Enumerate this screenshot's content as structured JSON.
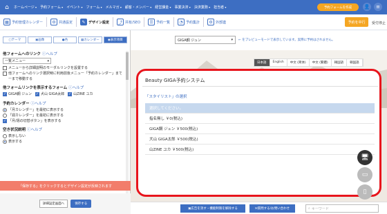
{
  "topbar": {
    "nav": [
      "ホームページ",
      "予約フォーム",
      "イベント",
      "フォーム",
      "メルマガ",
      "顧客・メンバー",
      "経営課金",
      "事業決済",
      "決済業務",
      "担当者"
    ],
    "cta_label": "予約フォームを作成",
    "accent": "#3d6ec2"
  },
  "toolbar": {
    "items": [
      {
        "label": "予約管理カレンダー",
        "icon": "calendar-icon"
      },
      {
        "label": "共通設定",
        "icon": "gear-icon"
      },
      {
        "label": "デザイン設定",
        "icon": "palette-icon"
      },
      {
        "label": "共有/SEO",
        "icon": "share-icon"
      },
      {
        "label": "予約一覧",
        "icon": "list-icon"
      },
      {
        "label": "予約集計",
        "icon": "chart-icon"
      },
      {
        "label": "外部連",
        "icon": "link-icon"
      }
    ],
    "trial_label": "予約を中行",
    "stop_label": "受付停止"
  },
  "left_tabs": [
    {
      "label": "テーマ"
    },
    {
      "label": "画像"
    },
    {
      "label": "色"
    },
    {
      "label": "カレンダー"
    },
    {
      "label": "表示項目"
    }
  ],
  "settings": {
    "help": "ヘルプ",
    "link_title": "他フォームへのリンク",
    "link_select": "一覧メニュー",
    "link_cb1": "メニューから詳細説明のモーダルリンクを設置する",
    "link_cb2": "他フォームへのリンク選択時に利用前後メニュー「予約カレンダー」まで移動する",
    "link_cb2b": "ーまで移動する",
    "show_title": "他フォームリンクを表示するフォーム",
    "forms": [
      "GIGA鋼 ジュン",
      "犬山 GIGA太郎",
      "山ZINE ユカ"
    ],
    "cal_title": "予約カレンダー",
    "cal_cb1": "「月カレンダー」を最初に表示する",
    "cal_cb2": "「週カレンダー」を最初に表示する",
    "cal_cb3": "「月/週の切替ボタン」を表示する",
    "vacancy_title": "空き状況説明",
    "vacancy_opt1": "表示しない",
    "vacancy_opt2": "表示する"
  },
  "notice": "「保存する」をクリックするとデザイン設定が反映されます",
  "footer": {
    "detail_label": "詳細設定画面へ",
    "save_label": "保存する"
  },
  "preview": {
    "select": "GIGA鋼 ジュン",
    "message": "← をプレビューモードで表示しています。実際に予約はされません。",
    "langs": [
      "日本語",
      "English",
      "中文 (简体)",
      "中文 (繁體)",
      "韓国語",
      "韓国語"
    ],
    "title": "Beauty GIGA予約システム",
    "subtitle": "「スタイリスト」の選択",
    "options": [
      "選択してください。",
      "指名無し ￥0(税込)",
      "GIGA鋼 ジュン ￥500(税込)",
      "犬山 GIGA太郎 ￥500(税込)",
      "山ZINE ユカ ￥500(税込)"
    ],
    "ad_label": "広告を消す・機能制限を解除する",
    "contact_label": "質問する/お問い合わせ",
    "search_placeholder": "キーワード"
  }
}
